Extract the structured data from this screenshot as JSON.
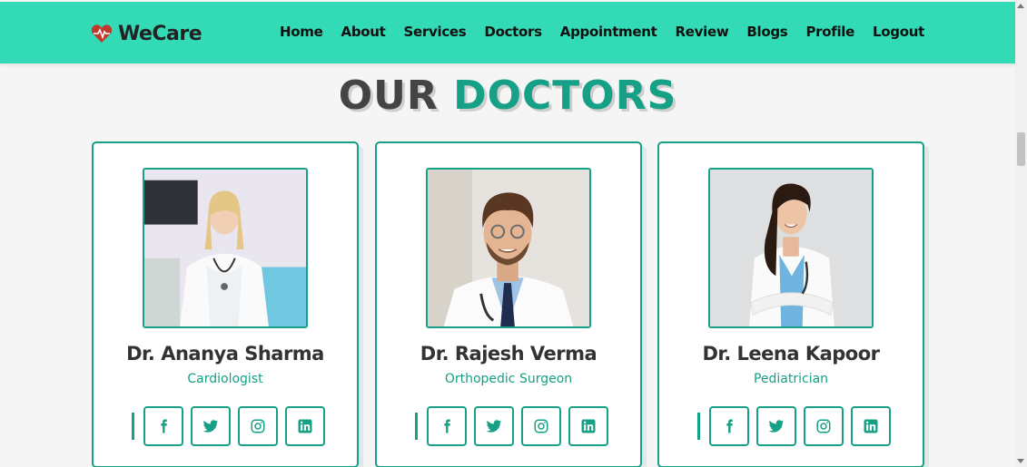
{
  "brand": {
    "name": "WeCare",
    "icon": "heart-pulse-icon",
    "icon_color": "#c0392b"
  },
  "nav": {
    "items": [
      "Home",
      "About",
      "Services",
      "Doctors",
      "Appointment",
      "Review",
      "Blogs",
      "Profile",
      "Logout"
    ]
  },
  "section": {
    "title_word1": "OUR",
    "title_word2": "DOCTORS"
  },
  "doctors": [
    {
      "name": "Dr. Ananya Sharma",
      "specialty": "Cardiologist"
    },
    {
      "name": "Dr. Rajesh Verma",
      "specialty": "Orthopedic Surgeon"
    },
    {
      "name": "Dr. Leena Kapoor",
      "specialty": "Pediatrician"
    }
  ],
  "social_icons": [
    "facebook-icon",
    "twitter-icon",
    "instagram-icon",
    "linkedin-icon"
  ],
  "colors": {
    "navbar": "#32dbb5",
    "accent": "#16a085",
    "heading": "#444444"
  }
}
